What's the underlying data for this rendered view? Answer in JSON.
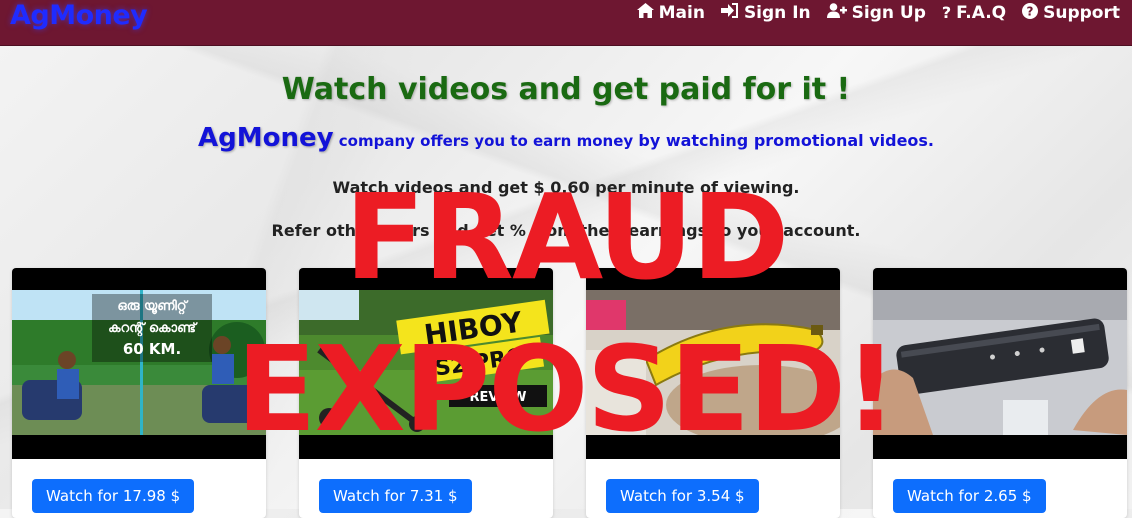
{
  "navbar": {
    "brand": "AgMoney",
    "items": [
      {
        "icon": "home-icon",
        "glyph": "🏠",
        "label": "Main"
      },
      {
        "icon": "sign-in-icon",
        "glyph": "➜",
        "label": "Sign In"
      },
      {
        "icon": "user-plus-icon",
        "glyph": "👤",
        "label": "Sign Up"
      },
      {
        "icon": "question-mark-icon",
        "glyph": "?",
        "label": "F.A.Q"
      },
      {
        "icon": "question-circle-icon",
        "glyph": "?",
        "label": "Support"
      }
    ],
    "background_color": "#6e1731",
    "brand_color": "#1f2bff"
  },
  "hero": {
    "headline": "Watch videos and get paid for it !",
    "sub_brand": "AgMoney",
    "sub_text": " company offers you to earn money ",
    "sub_strong": "by watching promotional videos.",
    "rate_text": "Watch videos and get $ 0.60 per minute of viewing.",
    "refer_text": "Refer other users and get  % from their earnings to your account."
  },
  "overlay": {
    "line1": "FRAUD",
    "line2": "EXPOSED!",
    "color": "#ec1c24"
  },
  "videos": [
    {
      "thumb_text": [
        "ഒരു യൂണിറ്റ്",
        "കറന്റ് കൊണ്ട്",
        "60 KM."
      ],
      "button": "Watch for 17.98 $"
    },
    {
      "thumb_text": [
        "HIBOY",
        "S2 PRO",
        "REVIEW"
      ],
      "button": "Watch for 7.31 $"
    },
    {
      "thumb_text": [],
      "button": "Watch for 3.54 $"
    },
    {
      "thumb_text": [],
      "button": "Watch for 2.65 $"
    }
  ],
  "button_color": "#0d6efd"
}
